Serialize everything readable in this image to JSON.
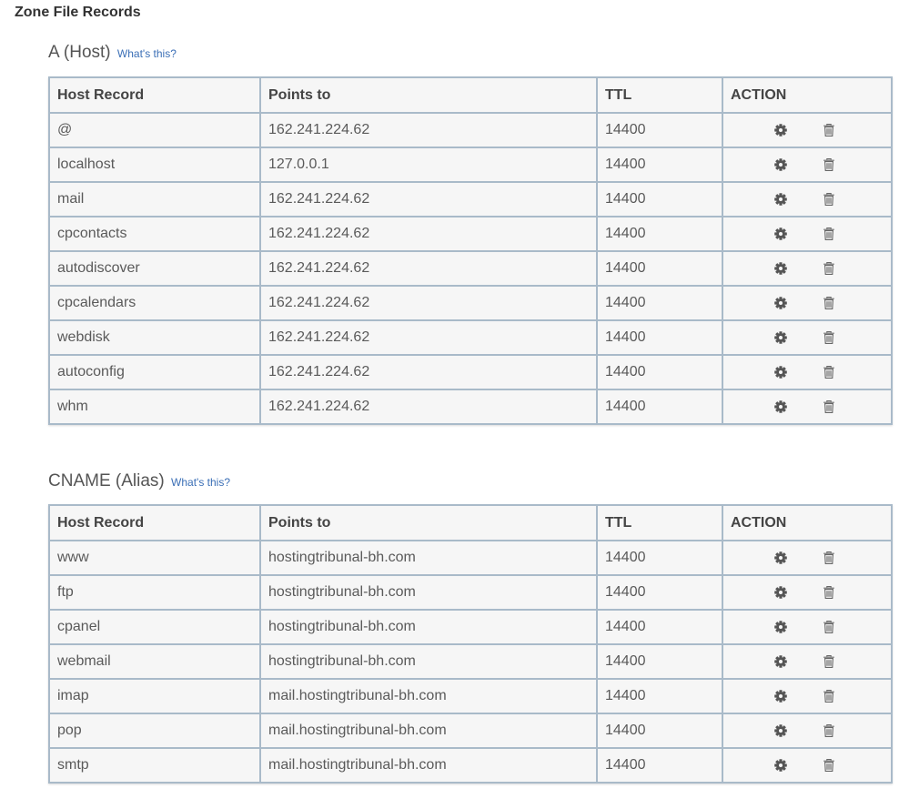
{
  "page": {
    "title": "Zone File Records"
  },
  "sections": {
    "a": {
      "heading": "A (Host)",
      "help_link": "What's this?"
    },
    "cname": {
      "heading": "CNAME (Alias)",
      "help_link": "What's this?"
    }
  },
  "columns": {
    "host": "Host Record",
    "points": "Points to",
    "ttl": "TTL",
    "action": "ACTION"
  },
  "a_records": [
    {
      "host": "@",
      "points": "162.241.224.62",
      "ttl": "14400"
    },
    {
      "host": "localhost",
      "points": "127.0.0.1",
      "ttl": "14400"
    },
    {
      "host": "mail",
      "points": "162.241.224.62",
      "ttl": "14400"
    },
    {
      "host": "cpcontacts",
      "points": "162.241.224.62",
      "ttl": "14400"
    },
    {
      "host": "autodiscover",
      "points": "162.241.224.62",
      "ttl": "14400"
    },
    {
      "host": "cpcalendars",
      "points": "162.241.224.62",
      "ttl": "14400"
    },
    {
      "host": "webdisk",
      "points": "162.241.224.62",
      "ttl": "14400"
    },
    {
      "host": "autoconfig",
      "points": "162.241.224.62",
      "ttl": "14400"
    },
    {
      "host": "whm",
      "points": "162.241.224.62",
      "ttl": "14400"
    }
  ],
  "cname_records": [
    {
      "host": "www",
      "points": "hostingtribunal-bh.com",
      "ttl": "14400"
    },
    {
      "host": "ftp",
      "points": "hostingtribunal-bh.com",
      "ttl": "14400"
    },
    {
      "host": "cpanel",
      "points": "hostingtribunal-bh.com",
      "ttl": "14400"
    },
    {
      "host": "webmail",
      "points": "hostingtribunal-bh.com",
      "ttl": "14400"
    },
    {
      "host": "imap",
      "points": "mail.hostingtribunal-bh.com",
      "ttl": "14400"
    },
    {
      "host": "pop",
      "points": "mail.hostingtribunal-bh.com",
      "ttl": "14400"
    },
    {
      "host": "smtp",
      "points": "mail.hostingtribunal-bh.com",
      "ttl": "14400"
    }
  ],
  "icons": {
    "edit": "gear-icon",
    "delete": "trash-icon"
  },
  "colors": {
    "table_border": "#a9bac9",
    "row_background": "#f6f6f6",
    "link": "#3b6fb6",
    "icon": "#555555"
  }
}
